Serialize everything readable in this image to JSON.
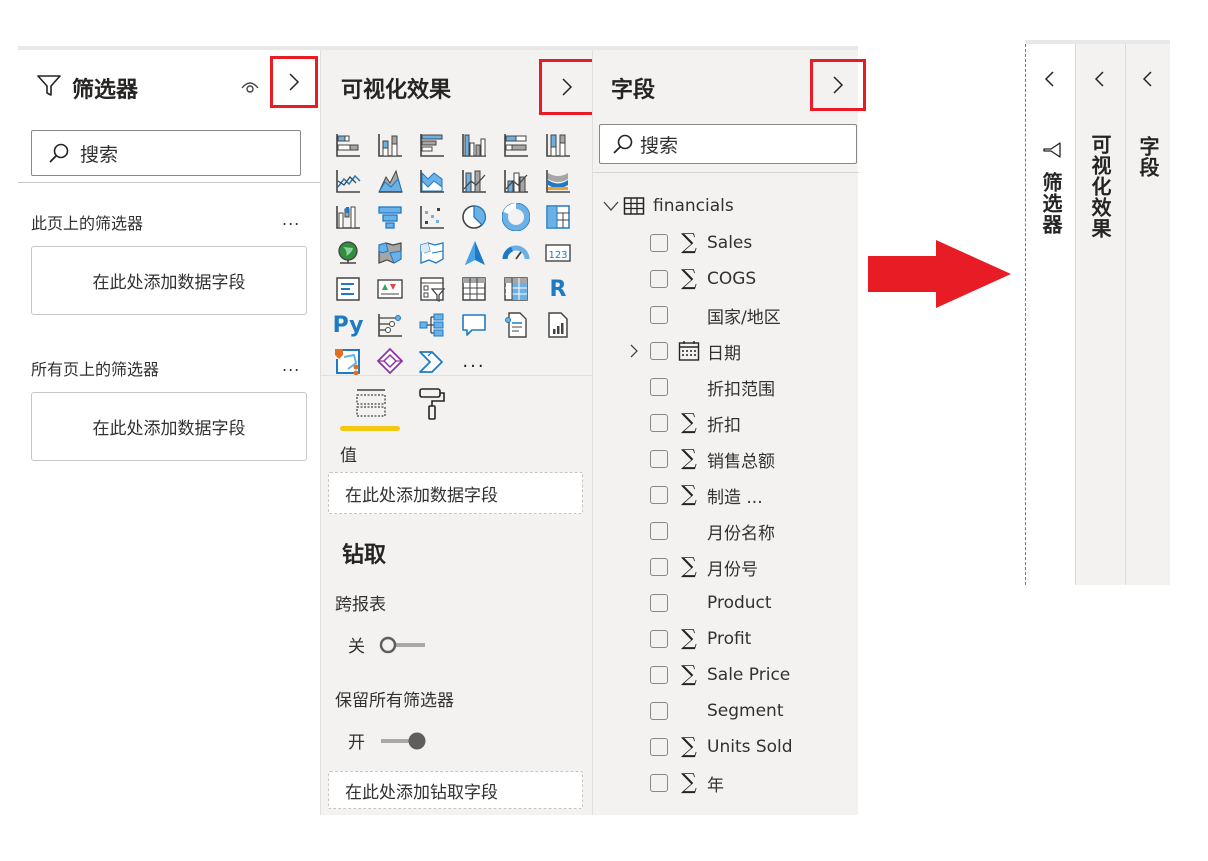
{
  "filters_pane": {
    "title": "筛选器",
    "search_placeholder": "搜索",
    "sections": [
      {
        "label": "此页上的筛选器",
        "more": "...",
        "well": "在此处添加数据字段"
      },
      {
        "label": "所有页上的筛选器",
        "more": "...",
        "well": "在此处添加数据字段"
      }
    ]
  },
  "viz_pane": {
    "title": "可视化效果",
    "visual_icons": [
      "stacked-bar-chart",
      "stacked-column-chart",
      "clustered-bar-chart",
      "clustered-column-chart",
      "100-percent-stacked-bar-chart",
      "100-percent-stacked-column-chart",
      "line-chart",
      "area-chart",
      "stacked-area-chart",
      "line-and-stacked-column-chart",
      "line-and-clustered-column-chart",
      "ribbon-chart",
      "waterfall-chart",
      "funnel-chart",
      "scatter-chart",
      "pie-chart",
      "donut-chart",
      "treemap",
      "map",
      "filled-map",
      "shape-map",
      "azure-map",
      "gauge",
      "card",
      "multi-row-card",
      "kpi",
      "slicer",
      "table",
      "matrix",
      "r-script-visual",
      "python-visual",
      "key-influencers",
      "decomposition-tree",
      "qa-visual",
      "smart-narrative",
      "paginated-report",
      "arcgis-map",
      "power-apps",
      "power-automate",
      "more-visuals"
    ],
    "r_label": "R",
    "py_label": "Py",
    "more_label": "...",
    "values_label": "值",
    "values_well": "在此处添加数据字段",
    "drillthrough_title": "钻取",
    "cross_report_label": "跨报表",
    "cross_report_toggle": {
      "label": "关",
      "on": false
    },
    "keep_filters_label": "保留所有筛选器",
    "keep_filters_toggle": {
      "label": "开",
      "on": true
    },
    "drillthrough_well": "在此处添加钻取字段"
  },
  "fields_pane": {
    "title": "字段",
    "search_placeholder": "搜索",
    "table_name": "financials",
    "fields": [
      {
        "name": "Sales",
        "type": "sigma"
      },
      {
        "name": "COGS",
        "type": "sigma"
      },
      {
        "name": "国家/地区",
        "type": "none"
      },
      {
        "name": "日期",
        "type": "calendar",
        "expandable": true
      },
      {
        "name": "折扣范围",
        "type": "none"
      },
      {
        "name": "折扣",
        "type": "sigma"
      },
      {
        "name": "销售总额",
        "type": "sigma"
      },
      {
        "name": "制造 ...",
        "type": "sigma"
      },
      {
        "name": "月份名称",
        "type": "none"
      },
      {
        "name": "月份号",
        "type": "sigma"
      },
      {
        "name": "Product",
        "type": "none"
      },
      {
        "name": "Profit",
        "type": "sigma"
      },
      {
        "name": "Sale Price",
        "type": "sigma"
      },
      {
        "name": "Segment",
        "type": "none"
      },
      {
        "name": "Units Sold",
        "type": "sigma"
      },
      {
        "name": "年",
        "type": "sigma"
      }
    ],
    "sigma_glyph": "∑"
  },
  "collapsed_panes": {
    "filters_label": "筛选器",
    "viz_label": "可视化效果",
    "fields_label": "字段"
  },
  "colors": {
    "highlight_red": "#e81c24",
    "accent_yellow": "#f2c811",
    "viz_blue": "#1e7ac4",
    "pane_bg": "#f3f2f1"
  }
}
